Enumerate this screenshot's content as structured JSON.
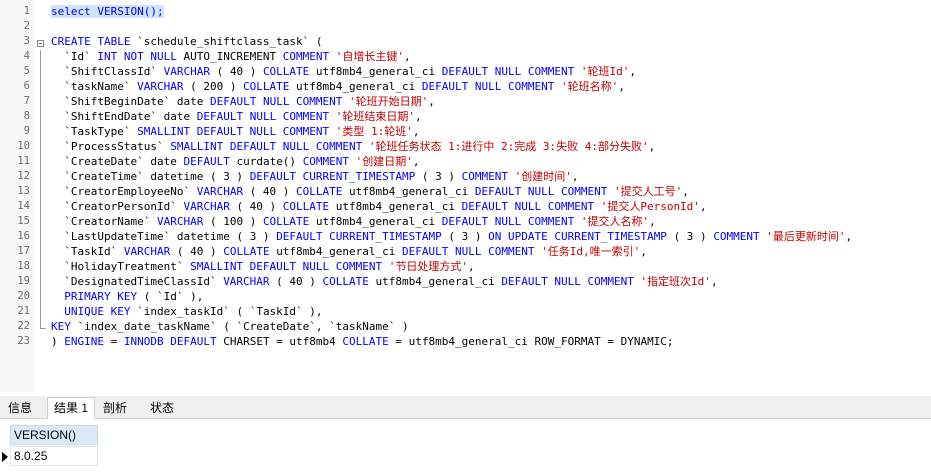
{
  "editor": {
    "line_numbers": [
      "1",
      "2",
      "3",
      "4",
      "5",
      "6",
      "7",
      "8",
      "9",
      "10",
      "11",
      "12",
      "13",
      "14",
      "15",
      "16",
      "17",
      "18",
      "19",
      "20",
      "21",
      "22",
      "23"
    ],
    "lines": [
      [
        {
          "t": "select VERSION();",
          "c": "kw sel"
        }
      ],
      [],
      [
        {
          "t": "CREATE TABLE ",
          "c": "kw"
        },
        {
          "t": "`schedule_shiftclass_task` (",
          "c": ""
        }
      ],
      [
        {
          "t": "  `Id` ",
          "c": ""
        },
        {
          "t": "INT NOT NULL ",
          "c": "kw"
        },
        {
          "t": "AUTO_INCREMENT ",
          "c": ""
        },
        {
          "t": "COMMENT ",
          "c": "kw"
        },
        {
          "t": "'自增长主键'",
          "c": "str"
        },
        {
          "t": ",",
          "c": ""
        }
      ],
      [
        {
          "t": "  `ShiftClassId` ",
          "c": ""
        },
        {
          "t": "VARCHAR ",
          "c": "kw"
        },
        {
          "t": "( 40 ) ",
          "c": ""
        },
        {
          "t": "COLLATE ",
          "c": "kw"
        },
        {
          "t": "utf8mb4_general_ci ",
          "c": ""
        },
        {
          "t": "DEFAULT NULL COMMENT ",
          "c": "kw"
        },
        {
          "t": "'轮班Id'",
          "c": "str"
        },
        {
          "t": ",",
          "c": ""
        }
      ],
      [
        {
          "t": "  `taskName` ",
          "c": ""
        },
        {
          "t": "VARCHAR ",
          "c": "kw"
        },
        {
          "t": "( 200 ) ",
          "c": ""
        },
        {
          "t": "COLLATE ",
          "c": "kw"
        },
        {
          "t": "utf8mb4_general_ci ",
          "c": ""
        },
        {
          "t": "DEFAULT NULL COMMENT ",
          "c": "kw"
        },
        {
          "t": "'轮班名称'",
          "c": "str"
        },
        {
          "t": ",",
          "c": ""
        }
      ],
      [
        {
          "t": "  `ShiftBeginDate` ",
          "c": ""
        },
        {
          "t": "date ",
          "c": ""
        },
        {
          "t": "DEFAULT NULL COMMENT ",
          "c": "kw"
        },
        {
          "t": "'轮班开始日期'",
          "c": "str"
        },
        {
          "t": ",",
          "c": ""
        }
      ],
      [
        {
          "t": "  `ShiftEndDate` ",
          "c": ""
        },
        {
          "t": "date ",
          "c": ""
        },
        {
          "t": "DEFAULT NULL COMMENT ",
          "c": "kw"
        },
        {
          "t": "'轮班结束日期'",
          "c": "str"
        },
        {
          "t": ",",
          "c": ""
        }
      ],
      [
        {
          "t": "  `TaskType` ",
          "c": ""
        },
        {
          "t": "SMALLINT DEFAULT NULL COMMENT ",
          "c": "kw"
        },
        {
          "t": "'类型 1:轮班'",
          "c": "str"
        },
        {
          "t": ",",
          "c": ""
        }
      ],
      [
        {
          "t": "  `ProcessStatus` ",
          "c": ""
        },
        {
          "t": "SMALLINT DEFAULT NULL COMMENT ",
          "c": "kw"
        },
        {
          "t": "'轮班任务状态 1:进行中 2:完成 3:失败 4:部分失败'",
          "c": "str"
        },
        {
          "t": ",",
          "c": ""
        }
      ],
      [
        {
          "t": "  `CreateDate` ",
          "c": ""
        },
        {
          "t": "date ",
          "c": ""
        },
        {
          "t": "DEFAULT ",
          "c": "kw"
        },
        {
          "t": "curdate() ",
          "c": ""
        },
        {
          "t": "COMMENT ",
          "c": "kw"
        },
        {
          "t": "'创建日期'",
          "c": "str"
        },
        {
          "t": ",",
          "c": ""
        }
      ],
      [
        {
          "t": "  `CreateTime` ",
          "c": ""
        },
        {
          "t": "datetime ( 3 ) ",
          "c": ""
        },
        {
          "t": "DEFAULT CURRENT_TIMESTAMP ",
          "c": "kw"
        },
        {
          "t": "( 3 ) ",
          "c": ""
        },
        {
          "t": "COMMENT ",
          "c": "kw"
        },
        {
          "t": "'创建时间'",
          "c": "str"
        },
        {
          "t": ",",
          "c": ""
        }
      ],
      [
        {
          "t": "  `CreatorEmployeeNo` ",
          "c": ""
        },
        {
          "t": "VARCHAR ",
          "c": "kw"
        },
        {
          "t": "( 40 ) ",
          "c": ""
        },
        {
          "t": "COLLATE ",
          "c": "kw"
        },
        {
          "t": "utf8mb4_general_ci ",
          "c": ""
        },
        {
          "t": "DEFAULT NULL COMMENT ",
          "c": "kw"
        },
        {
          "t": "'提交人工号'",
          "c": "str"
        },
        {
          "t": ",",
          "c": ""
        }
      ],
      [
        {
          "t": "  `CreatorPersonId` ",
          "c": ""
        },
        {
          "t": "VARCHAR ",
          "c": "kw"
        },
        {
          "t": "( 40 ) ",
          "c": ""
        },
        {
          "t": "COLLATE ",
          "c": "kw"
        },
        {
          "t": "utf8mb4_general_ci ",
          "c": ""
        },
        {
          "t": "DEFAULT NULL COMMENT ",
          "c": "kw"
        },
        {
          "t": "'提交人PersonId'",
          "c": "str"
        },
        {
          "t": ",",
          "c": ""
        }
      ],
      [
        {
          "t": "  `CreatorName` ",
          "c": ""
        },
        {
          "t": "VARCHAR ",
          "c": "kw"
        },
        {
          "t": "( 100 ) ",
          "c": ""
        },
        {
          "t": "COLLATE ",
          "c": "kw"
        },
        {
          "t": "utf8mb4_general_ci ",
          "c": ""
        },
        {
          "t": "DEFAULT NULL COMMENT ",
          "c": "kw"
        },
        {
          "t": "'提交人名称'",
          "c": "str"
        },
        {
          "t": ",",
          "c": ""
        }
      ],
      [
        {
          "t": "  `LastUpdateTime` ",
          "c": ""
        },
        {
          "t": "datetime ( 3 ) ",
          "c": ""
        },
        {
          "t": "DEFAULT CURRENT_TIMESTAMP ",
          "c": "kw"
        },
        {
          "t": "( 3 ) ",
          "c": ""
        },
        {
          "t": "ON UPDATE CURRENT_TIMESTAMP ",
          "c": "kw"
        },
        {
          "t": "( 3 ) ",
          "c": ""
        },
        {
          "t": "COMMENT ",
          "c": "kw"
        },
        {
          "t": "'最后更新时间'",
          "c": "str"
        },
        {
          "t": ",",
          "c": ""
        }
      ],
      [
        {
          "t": "  `TaskId` ",
          "c": ""
        },
        {
          "t": "VARCHAR ",
          "c": "kw"
        },
        {
          "t": "( 40 ) ",
          "c": ""
        },
        {
          "t": "COLLATE ",
          "c": "kw"
        },
        {
          "t": "utf8mb4_general_ci ",
          "c": ""
        },
        {
          "t": "DEFAULT NULL COMMENT ",
          "c": "kw"
        },
        {
          "t": "'任务Id,唯一索引'",
          "c": "str"
        },
        {
          "t": ",",
          "c": ""
        }
      ],
      [
        {
          "t": "  `HolidayTreatment` ",
          "c": ""
        },
        {
          "t": "SMALLINT DEFAULT NULL COMMENT ",
          "c": "kw"
        },
        {
          "t": "'节日处理方式'",
          "c": "str"
        },
        {
          "t": ",",
          "c": ""
        }
      ],
      [
        {
          "t": "  `DesignatedTimeClassId` ",
          "c": ""
        },
        {
          "t": "VARCHAR ",
          "c": "kw"
        },
        {
          "t": "( 40 ) ",
          "c": ""
        },
        {
          "t": "COLLATE ",
          "c": "kw"
        },
        {
          "t": "utf8mb4_general_ci ",
          "c": ""
        },
        {
          "t": "DEFAULT NULL COMMENT ",
          "c": "kw"
        },
        {
          "t": "'指定班次Id'",
          "c": "str"
        },
        {
          "t": ",",
          "c": ""
        }
      ],
      [
        {
          "t": "  ",
          "c": ""
        },
        {
          "t": "PRIMARY KEY ",
          "c": "kw"
        },
        {
          "t": "( `Id` ),",
          "c": ""
        }
      ],
      [
        {
          "t": "  ",
          "c": ""
        },
        {
          "t": "UNIQUE KEY ",
          "c": "kw"
        },
        {
          "t": "`index_taskId` ( `TaskId` ),",
          "c": ""
        }
      ],
      [
        {
          "t": "KEY ",
          "c": "kw"
        },
        {
          "t": "`index_date_taskName` ( `CreateDate`, `taskName` )",
          "c": ""
        }
      ],
      [
        {
          "t": ") ",
          "c": ""
        },
        {
          "t": "ENGINE ",
          "c": "kw"
        },
        {
          "t": "= ",
          "c": ""
        },
        {
          "t": "INNODB DEFAULT ",
          "c": "kw"
        },
        {
          "t": "CHARSET = utf8mb4 ",
          "c": ""
        },
        {
          "t": "COLLATE ",
          "c": "kw"
        },
        {
          "t": "= utf8mb4_general_ci ROW_FORMAT = DYNAMIC;",
          "c": ""
        }
      ]
    ]
  },
  "tabs": [
    {
      "label": "信息",
      "active": false
    },
    {
      "label": "结果 1",
      "active": true
    },
    {
      "label": "剖析",
      "active": false
    },
    {
      "label": "状态",
      "active": false
    }
  ],
  "result": {
    "column_header": "VERSION()",
    "value": "8.0.25"
  },
  "icons": {
    "row_indicator": "row-pointer-icon",
    "fold": "fold-toggle-icon"
  },
  "colors": {
    "keyword": "#0000ff",
    "string": "#c00000",
    "selection": "#cfe3fb",
    "header_bg": "#dce9f6"
  }
}
